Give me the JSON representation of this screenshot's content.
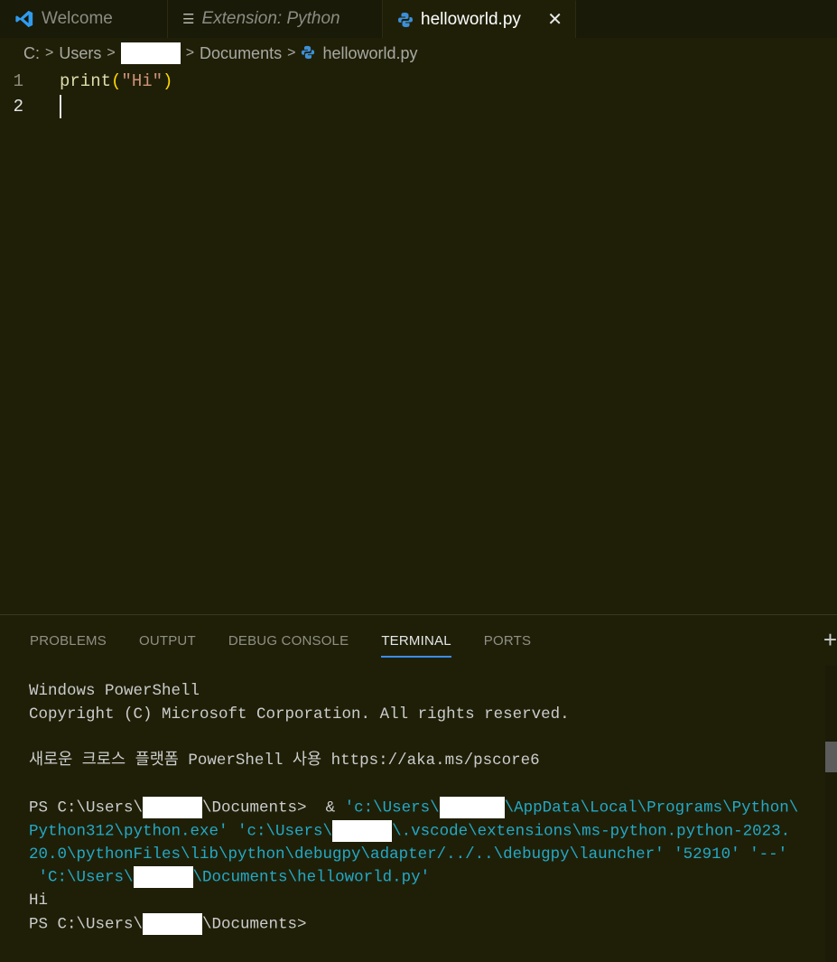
{
  "tabs": [
    {
      "label": "Welcome",
      "icon": "vscode-logo-icon"
    },
    {
      "label": "Extension: Python",
      "icon": "preview-doc-icon"
    },
    {
      "label": "helloworld.py",
      "icon": "python-file-icon",
      "close": "✕"
    }
  ],
  "breadcrumb": {
    "drive": "C:",
    "users": "Users",
    "documents": "Documents",
    "file": "helloworld.py",
    "sep": ">"
  },
  "editor": {
    "lines": [
      {
        "number": "1",
        "fn": "print",
        "open": "(",
        "str": "\"Hi\"",
        "close": ")"
      },
      {
        "number": "2"
      }
    ]
  },
  "panel": {
    "tabs": [
      "PROBLEMS",
      "OUTPUT",
      "DEBUG CONSOLE",
      "TERMINAL",
      "PORTS"
    ],
    "active_tab": "TERMINAL",
    "plus": "+"
  },
  "terminal": {
    "l1": "Windows PowerShell",
    "l2": "Copyright (C) Microsoft Corporation. All rights reserved.",
    "l3": "새로운 크로스 플랫폼 PowerShell 사용 https://aka.ms/pscore6",
    "prompt_a": "PS C:\\Users\\",
    "prompt_b": "\\Documents>",
    "amp": "&",
    "c1a": "'c:\\Users\\",
    "c1b": "\\AppData\\Local\\Programs\\Python\\",
    "c2a": "Python312\\python.exe' 'c:\\Users\\",
    "c2b": "\\.vscode\\extensions\\ms-python.python-2023.",
    "c3": "20.0\\pythonFiles\\lib\\python\\debugpy\\adapter/../..\\debugpy\\launcher' '52910' '--'",
    "c4a": "'C:\\Users\\",
    "c4b": "\\Documents\\helloworld.py'",
    "output": "Hi"
  },
  "colors": {
    "background": "#1f1f08",
    "terminal_command": "#23a9c6",
    "active_tab_underline": "#3b8eea"
  }
}
